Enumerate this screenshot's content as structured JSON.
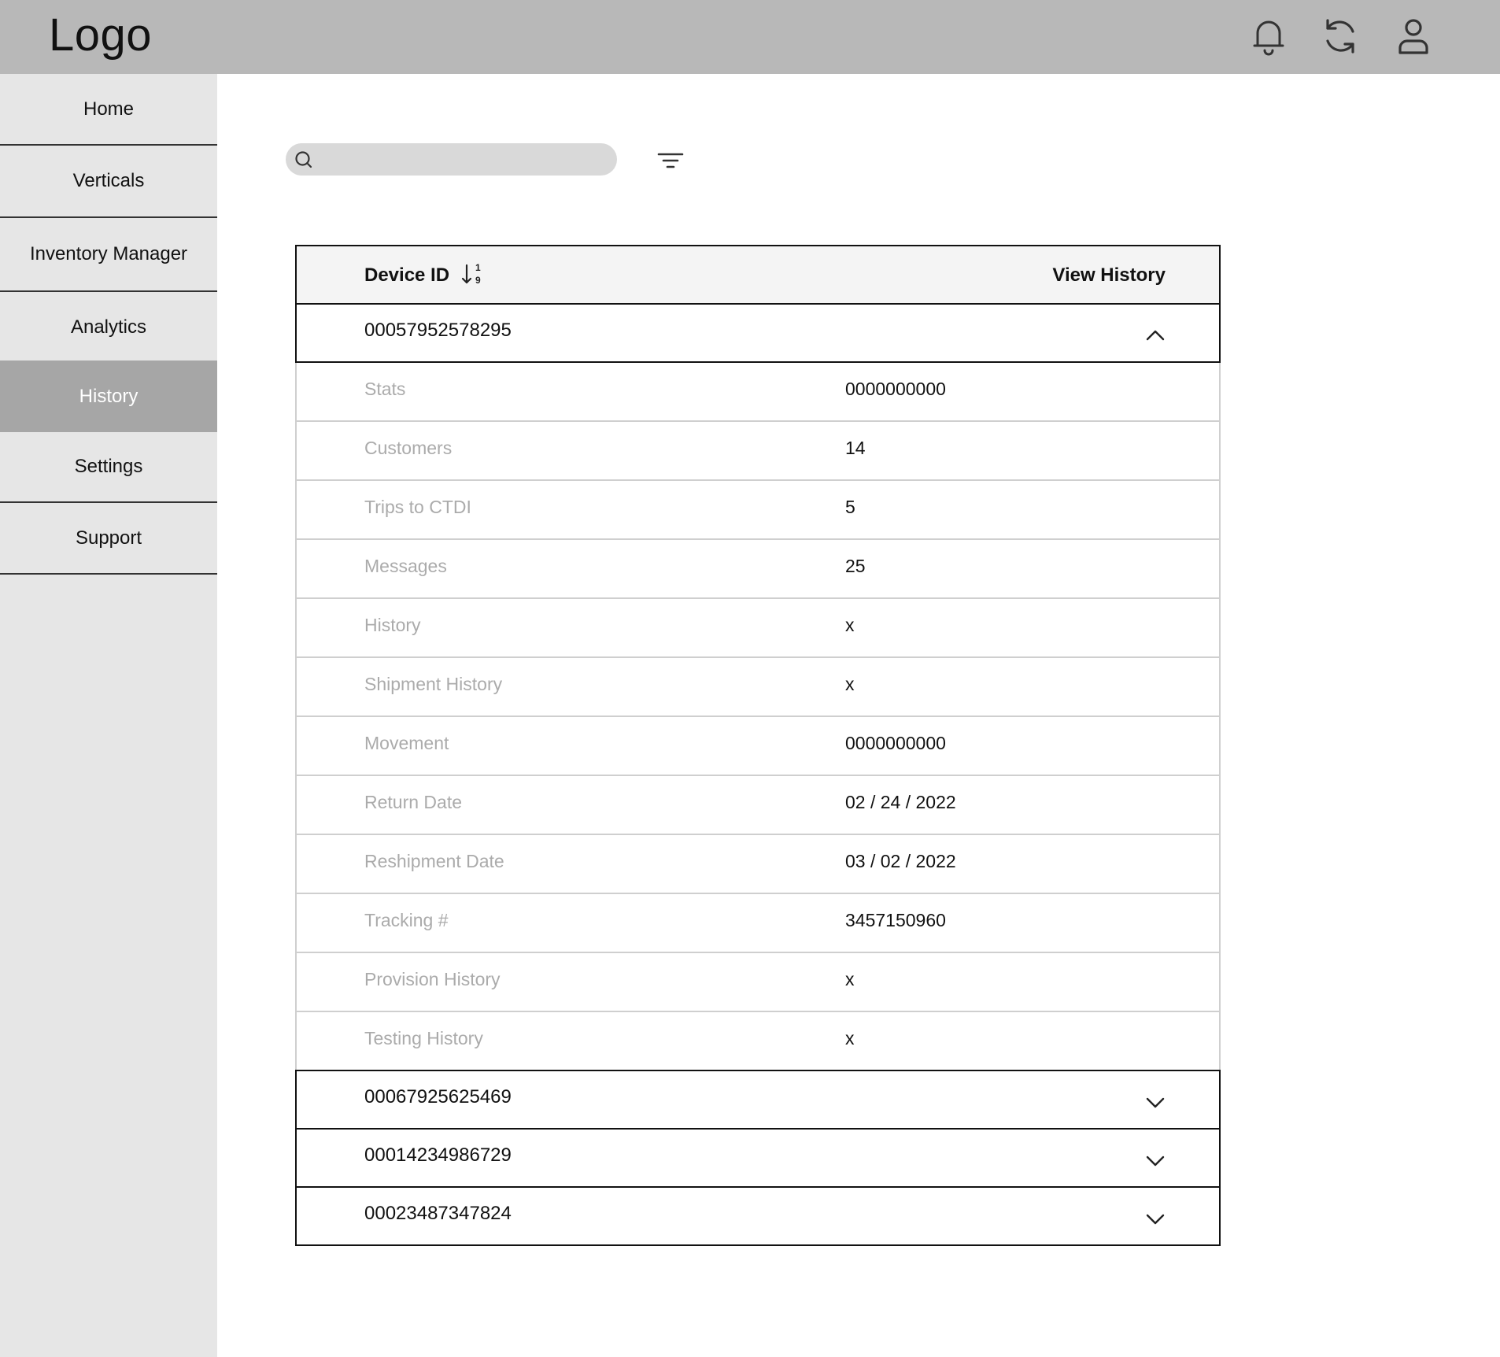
{
  "header": {
    "logo": "Logo",
    "icons": [
      "bell-icon",
      "sync-icon",
      "user-icon"
    ]
  },
  "sidebar": {
    "items": [
      {
        "label": "Home",
        "active": false
      },
      {
        "label": "Verticals",
        "active": false
      },
      {
        "label": "Inventory Manager",
        "active": false
      },
      {
        "label": "Analytics",
        "active": false
      },
      {
        "label": "History",
        "active": true
      },
      {
        "label": "Settings",
        "active": false
      },
      {
        "label": "Support",
        "active": false
      }
    ]
  },
  "search": {
    "value": "",
    "placeholder": ""
  },
  "table": {
    "columns": {
      "device_id": "Device ID",
      "view_history": "View History"
    },
    "expanded_device": {
      "id": "00057952578295",
      "details": [
        {
          "label": "Stats",
          "value": "0000000000"
        },
        {
          "label": "Customers",
          "value": "14"
        },
        {
          "label": "Trips to CTDI",
          "value": "5"
        },
        {
          "label": "Messages",
          "value": "25"
        },
        {
          "label": "History",
          "value": "x"
        },
        {
          "label": "Shipment History",
          "value": "x"
        },
        {
          "label": "Movement",
          "value": "0000000000"
        },
        {
          "label": "Return Date",
          "value": "02 / 24 / 2022"
        },
        {
          "label": "Reshipment Date",
          "value": "03 / 02 / 2022"
        },
        {
          "label": "Tracking #",
          "value": "3457150960"
        },
        {
          "label": "Provision History",
          "value": "x"
        },
        {
          "label": "Testing History",
          "value": "x"
        }
      ]
    },
    "collapsed_devices": [
      {
        "id": "00067925625469"
      },
      {
        "id": "00014234986729"
      },
      {
        "id": "00023487347824"
      }
    ]
  },
  "colors": {
    "header_bg": "#b8b8b8",
    "sidebar_bg": "#e6e6e6",
    "active_nav_bg": "#a6a6a6",
    "detail_label": "#ababab"
  }
}
